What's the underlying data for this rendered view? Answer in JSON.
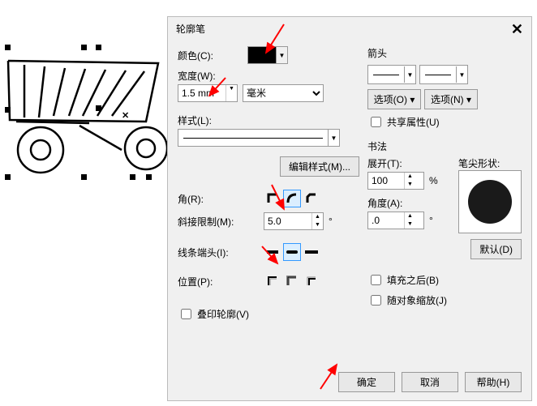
{
  "dialog": {
    "title": "轮廓笔",
    "color_label": "颜色(C):",
    "width_label": "宽度(W):",
    "width_value": "1.5 mm",
    "unit_value": "毫米",
    "style_label": "样式(L):",
    "edit_style_btn": "编辑样式(M)...",
    "corner_label": "角(R):",
    "miter_label": "斜接限制(M):",
    "miter_value": "5.0",
    "cap_label": "线条端头(I):",
    "position_label": "位置(P):",
    "overlap_label": "叠印轮廓(V)"
  },
  "arrows": {
    "section": "箭头",
    "option_left": "选项(O)",
    "option_right": "选项(N)",
    "share_label": "共享属性(U)"
  },
  "callig": {
    "section": "书法",
    "spread_label": "展开(T):",
    "spread_value": "100",
    "angle_label": "角度(A):",
    "angle_value": ".0",
    "nib_label": "笔尖形状:",
    "default_btn": "默认(D)"
  },
  "checks": {
    "behind_fill": "填充之后(B)",
    "scale_with": "随对象缩放(J)"
  },
  "footer": {
    "ok": "确定",
    "cancel": "取消",
    "help": "帮助(H)"
  }
}
